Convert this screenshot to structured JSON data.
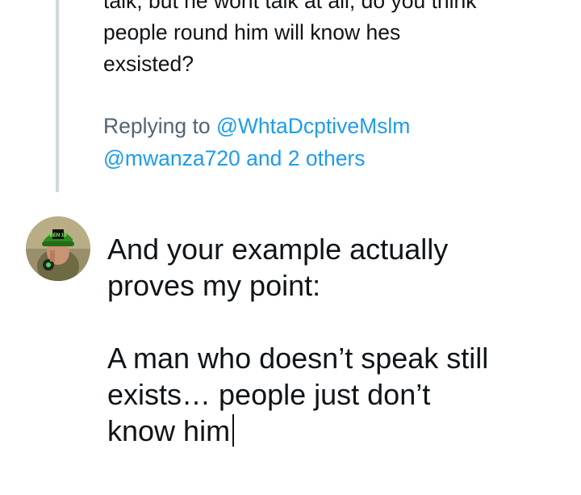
{
  "parent_tweet": {
    "text": "talk, but he wont talk at all, do you think\npeople round him will know hes\nexsisted?"
  },
  "replying": {
    "prefix": "Replying to ",
    "mention_1": "@WhtaDcptiveMslm",
    "mention_2": "@mwanza720",
    "connector": " and ",
    "others": "2 others"
  },
  "avatar": {
    "cap_text": "BEN 10"
  },
  "compose": {
    "text": "And your example actually\nproves my point:\n\nA man who doesn’t speak still\nexists… people just don’t\nknow him"
  },
  "colors": {
    "link": "#1d9bf0",
    "secondary_text": "#536471",
    "thread_line": "#cfd9de",
    "primary_text": "#0f1419"
  }
}
